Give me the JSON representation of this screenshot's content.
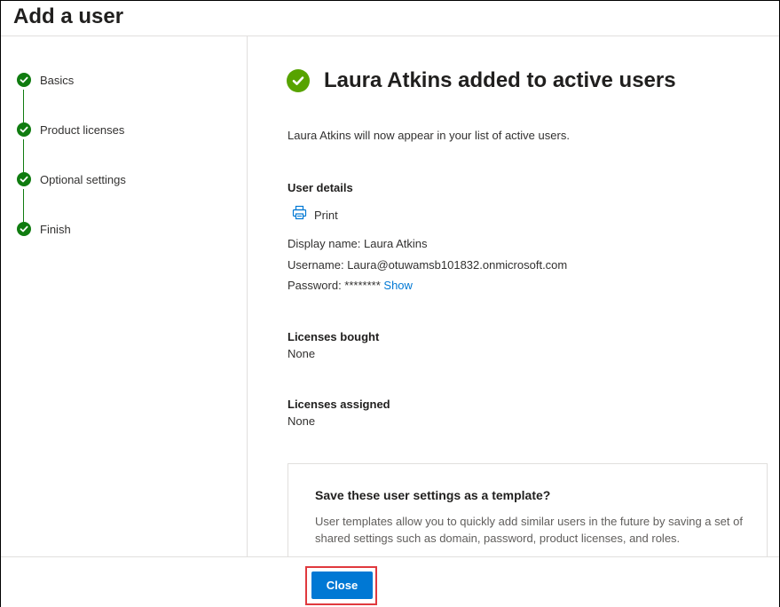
{
  "header": {
    "title": "Add a user"
  },
  "steps": [
    {
      "label": "Basics",
      "status": "complete"
    },
    {
      "label": "Product licenses",
      "status": "complete"
    },
    {
      "label": "Optional settings",
      "status": "complete"
    },
    {
      "label": "Finish",
      "status": "complete"
    }
  ],
  "main": {
    "success_title": "Laura Atkins added to active users",
    "intro": "Laura Atkins will now appear in your list of active users.",
    "user_details_heading": "User details",
    "print_label": "Print",
    "display_name": "Display name: Laura Atkins",
    "username": "Username: Laura@otuwamsb101832.onmicrosoft.com",
    "password_label": "Password: ********",
    "show_link": "Show",
    "licenses_bought_heading": "Licenses bought",
    "licenses_bought_value": "None",
    "licenses_assigned_heading": "Licenses assigned",
    "licenses_assigned_value": "None"
  },
  "template_card": {
    "title": "Save these user settings as a template?",
    "body": "User templates allow you to quickly add similar users in the future by saving a set of shared settings such as domain, password, product licenses, and roles."
  },
  "footer": {
    "close_label": "Close"
  },
  "icons": {
    "step_complete": "checkmark-circle-icon",
    "success": "checkmark-circle-icon",
    "print": "printer-icon"
  },
  "colors": {
    "step_green": "#107c10",
    "success_green": "#57a300",
    "primary_blue": "#0078d4",
    "highlight_red": "#e0393e"
  }
}
